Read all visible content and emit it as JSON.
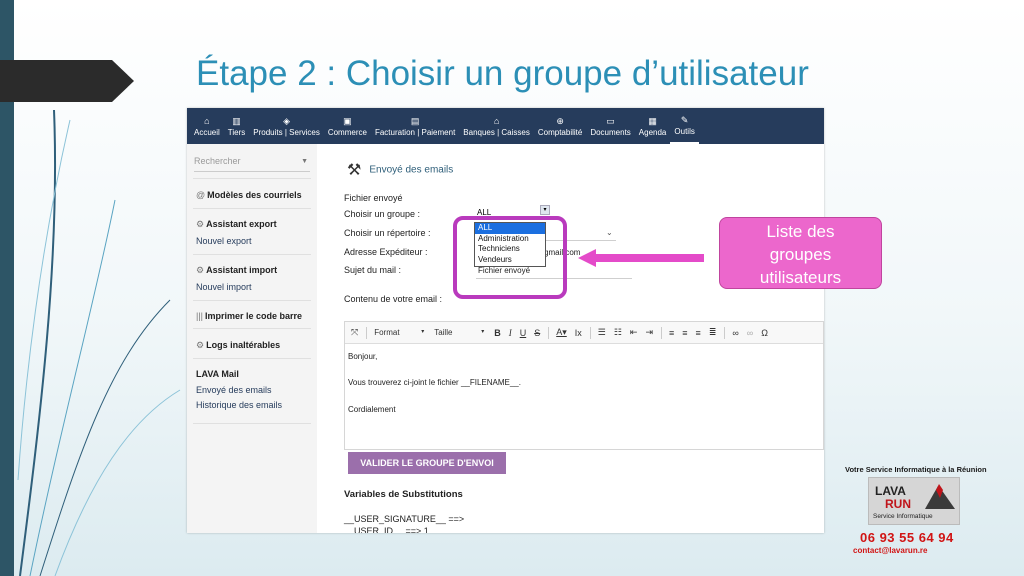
{
  "slide": {
    "title": "Étape 2 : Choisir un groupe d’utilisateur",
    "callout": [
      "Liste des",
      "groupes",
      "utilisateurs"
    ]
  },
  "nav": [
    {
      "label": "Accueil",
      "icon": "home-icon",
      "glyph": "⌂"
    },
    {
      "label": "Tiers",
      "icon": "building-icon",
      "glyph": "▥"
    },
    {
      "label": "Produits | Services",
      "icon": "cube-icon",
      "glyph": "◈"
    },
    {
      "label": "Commerce",
      "icon": "briefcase-icon",
      "glyph": "▣"
    },
    {
      "label": "Facturation | Paiement",
      "icon": "invoice-icon",
      "glyph": "▤"
    },
    {
      "label": "Banques | Caisses",
      "icon": "bank-icon",
      "glyph": "⌂"
    },
    {
      "label": "Comptabilité",
      "icon": "magnifier-icon",
      "glyph": "⊕"
    },
    {
      "label": "Documents",
      "icon": "folder-icon",
      "glyph": "▭"
    },
    {
      "label": "Agenda",
      "icon": "calendar-icon",
      "glyph": "▦"
    },
    {
      "label": "Outils",
      "icon": "wrench-icon",
      "glyph": "✎"
    }
  ],
  "sidebar": {
    "search_placeholder": "Rechercher",
    "sections": [
      {
        "head": "Modèles des courriels",
        "icon": "@",
        "links": []
      },
      {
        "head": "Assistant export",
        "icon": "⚙",
        "links": [
          "Nouvel export"
        ]
      },
      {
        "head": "Assistant import",
        "icon": "⚙",
        "links": [
          "Nouvel import"
        ]
      },
      {
        "head": "Imprimer le code barre",
        "icon": "|||",
        "links": []
      },
      {
        "head": "Logs inaltérables",
        "icon": "⚙",
        "links": []
      },
      {
        "head": "LAVA Mail",
        "icon": "",
        "links": [
          "Envoyé des emails",
          "Historique des emails"
        ]
      }
    ]
  },
  "form": {
    "page_title": "Envoyé des emails",
    "fichier_label": "Fichier envoyé",
    "groupe_label": "Choisir un groupe :",
    "repertoire_label": "Choisir un répertoire :",
    "expediteur_label": "Adresse Expéditeur :",
    "expediteur_value": "gmail.com",
    "sujet_label": "Sujet du mail :",
    "sujet_value": "Fichier envoyé",
    "contenu_label": "Contenu de votre email :",
    "selected_group": "ALL",
    "group_options": [
      "ALL",
      "Administration",
      "Techniciens",
      "Vendeurs"
    ]
  },
  "editor": {
    "format_label": "Format",
    "size_label": "Taille",
    "lines": [
      "Bonjour,",
      "Vous trouverez ci-joint le fichier __FILENAME__.",
      "Cordialement"
    ]
  },
  "validate_button": "VALIDER LE GROUPE D'ENVOI",
  "variables": {
    "title": "Variables de Substitutions",
    "items": [
      "__USER_SIGNATURE__ ==>",
      "__USER_ID__ ==> 1"
    ]
  },
  "brand": {
    "tagline": "Votre Service Informatique à la Réunion",
    "logo_line1": "LAVA",
    "logo_line2": "RUN",
    "logo_sub": "Service Informatique",
    "phone": "06 93 55 64 94",
    "email": "contact@lavarun.re"
  }
}
